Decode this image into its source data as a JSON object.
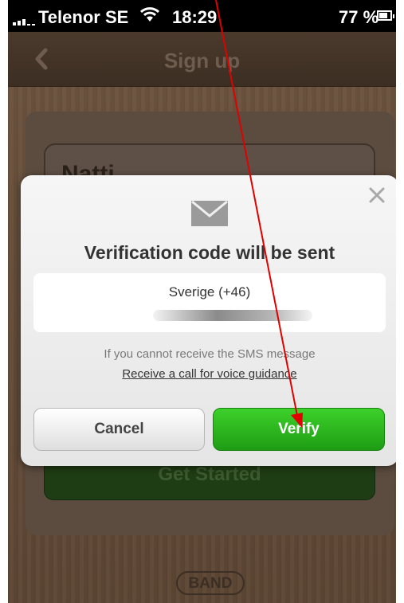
{
  "status_bar": {
    "carrier": "Telenor SE",
    "time": "18:29",
    "battery": "77 %"
  },
  "nav": {
    "title": "Sign up"
  },
  "form": {
    "name_value": "Natti",
    "get_started_label": "Get Started"
  },
  "brand": {
    "logo_text": "BAND"
  },
  "modal": {
    "title": "Verification code will be sent",
    "country": "Sverige (+46)",
    "info_text": "If you cannot receive the SMS message",
    "voice_link": "Receive a call for voice guidance",
    "cancel_label": "Cancel",
    "verify_label": "Verify"
  },
  "colors": {
    "verify_green": "#2bb51c",
    "arrow_red": "#e00000"
  }
}
